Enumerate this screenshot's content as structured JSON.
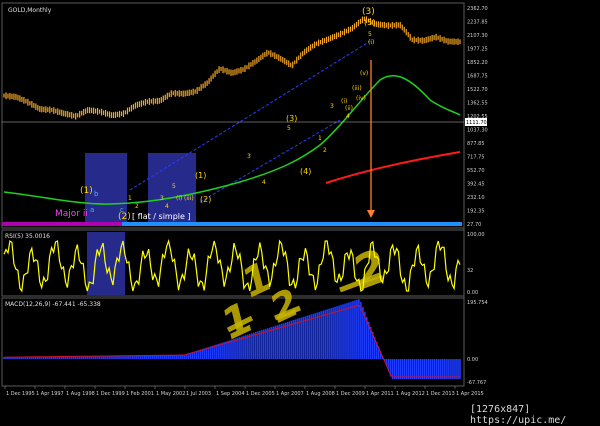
{
  "window": {
    "title": "GOLD,Monthly"
  },
  "colors": {
    "background": "#000000",
    "price_bars": "#f5a623",
    "rsi_line": "#ffff00",
    "macd_hist": "#1e3cff",
    "macd_signal": "#d0102a",
    "ma_green": "#1fd11f",
    "ma_red": "#ff1a1a",
    "highlight_box": "#2a2f9a",
    "wave_blue": "#2a3cff",
    "wave_yellow": "#ffd400",
    "major_label": "#ff40ff",
    "arrow_orange": "#ff7f2a",
    "handwriting": "#c8b400"
  },
  "price_axis": {
    "labels": [
      "2362.70",
      "2237.85",
      "2107.30",
      "1977.25",
      "1852.20",
      "1687.75",
      "1522.70",
      "1362.55",
      "1202.55",
      "1037.30",
      "877.85",
      "717.75",
      "552.70",
      "392.45",
      "232.10",
      "192.35",
      "27.70"
    ],
    "current_price": "1111.70"
  },
  "rsi_panel": {
    "title": "RSI(5) 35.0016",
    "axis_labels": [
      "100.00",
      "32",
      "0.00"
    ]
  },
  "macd_panel": {
    "title": "MACD(12,26,9) -67.441 -65.338",
    "axis_labels": [
      "195.754",
      "0.00",
      "-67.767"
    ]
  },
  "time_axis": {
    "labels": [
      "1 Dec 1995",
      "1 Apr 1997",
      "1 Aug 1998",
      "1 Dec 1999",
      "1 Feb 2001",
      "1 May 2002",
      "1 Jul 2003",
      "1 Sep 2004",
      "1 Dec 2005",
      "1 Apr 2007",
      "1 Aug 2008",
      "1 Dec 2009",
      "1 Apr 2011",
      "1 Aug 2012",
      "1 Dec 2013",
      "1 Apr 2015"
    ]
  },
  "annotations": {
    "wave1_major": "(1)",
    "wave2_major": "(2)",
    "wave3_major": "(3)",
    "wave4_major": "(4)",
    "wave5_top": "(5)",
    "major_ii": "Major ii",
    "flat_simple": "[ flat / simple ]",
    "wave_a": "a",
    "wave_b": "b",
    "wave_c": "c",
    "minor_labels": [
      "1",
      "2",
      "3",
      "4",
      "5",
      "(i)",
      "(ii)",
      "(iii)",
      "(iv)",
      "(v)"
    ]
  },
  "handwriting": {
    "mark1": "1",
    "mark2": "2",
    "mark3": "2",
    "mark4": "3"
  },
  "watermark": "[1276x847] https://upic.me/",
  "chart_data": {
    "type": "line",
    "title": "GOLD,Monthly",
    "series": [
      {
        "name": "GOLD",
        "x": [
          "1995-12",
          "1996-06",
          "1997-04",
          "1997-12",
          "1998-08",
          "1999-02",
          "1999-08",
          "1999-12",
          "2000-06",
          "2001-02",
          "2001-08",
          "2002-05",
          "2002-12",
          "2003-07",
          "2004-01",
          "2004-09",
          "2005-04",
          "2005-12",
          "2006-05",
          "2006-12",
          "2007-04",
          "2007-11",
          "2008-03",
          "2008-08",
          "2008-10",
          "2009-03",
          "2009-12",
          "2010-06",
          "2010-12",
          "2011-04",
          "2011-09",
          "2012-03",
          "2012-08",
          "2013-01",
          "2013-06",
          "2013-12",
          "2014-06",
          "2014-12",
          "2015-04"
        ],
        "values": [
          390,
          380,
          340,
          295,
          290,
          270,
          255,
          290,
          280,
          260,
          270,
          320,
          345,
          350,
          410,
          405,
          425,
          510,
          680,
          620,
          670,
          790,
          950,
          840,
          720,
          950,
          1130,
          1240,
          1380,
          1550,
          1900,
          1700,
          1650,
          1670,
          1230,
          1210,
          1300,
          1190,
          1180
        ]
      }
    ],
    "ylim": [
      27.7,
      2362.7
    ],
    "grid": false
  }
}
